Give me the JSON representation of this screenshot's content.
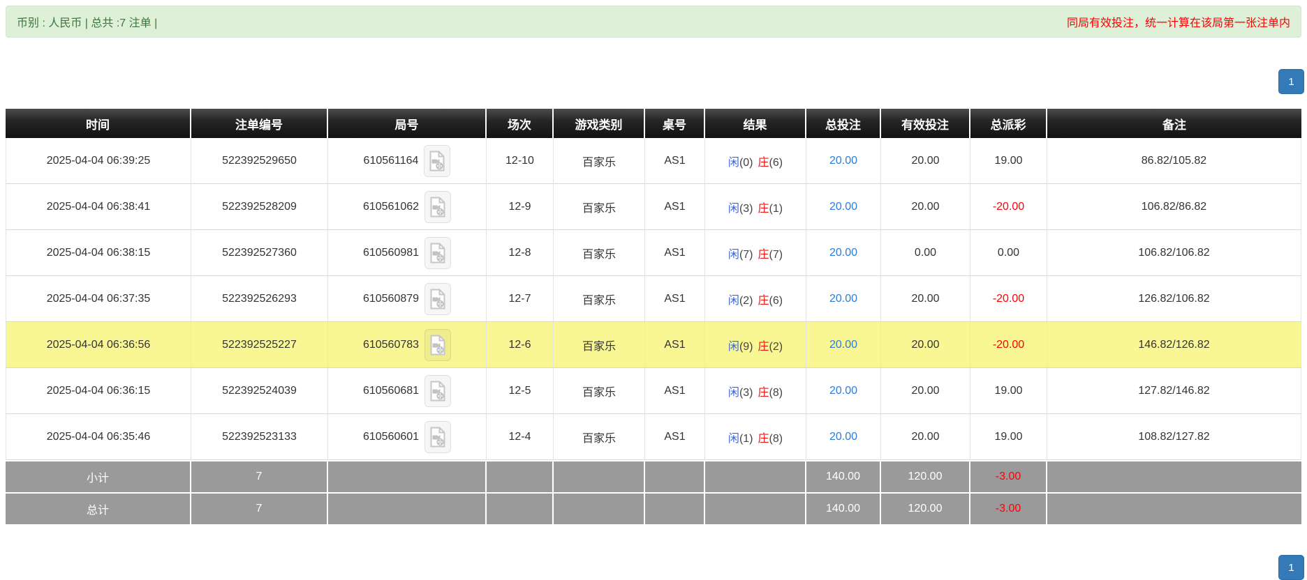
{
  "top_bar": {
    "summary": "币别 : 人民币 | 总共 :7 注单 |",
    "notice": "同局有效投注，统一计算在该局第一张注单内"
  },
  "pagination": {
    "current_page": "1"
  },
  "table": {
    "columns": [
      "时间",
      "注单编号",
      "局号",
      "场次",
      "游戏类别",
      "桌号",
      "结果",
      "总投注",
      "有效投注",
      "总派彩",
      "备注"
    ],
    "icons": {
      "round_cell": "video-file-icon"
    },
    "rows": [
      {
        "time": "2025-04-04 06:39:25",
        "bet_id": "522392529650",
        "round_no": "610561164",
        "session": "12-10",
        "game_type": "百家乐",
        "table_no": "AS1",
        "result": {
          "player_label": "闲",
          "player_score": "(0)",
          "banker_label": "庄",
          "banker_score": "(6)"
        },
        "total_bet": "20.00",
        "valid_bet": "20.00",
        "payout": "19.00",
        "remark": "86.82/105.82",
        "highlighted": false
      },
      {
        "time": "2025-04-04 06:38:41",
        "bet_id": "522392528209",
        "round_no": "610561062",
        "session": "12-9",
        "game_type": "百家乐",
        "table_no": "AS1",
        "result": {
          "player_label": "闲",
          "player_score": "(3)",
          "banker_label": "庄",
          "banker_score": "(1)"
        },
        "total_bet": "20.00",
        "valid_bet": "20.00",
        "payout": "-20.00",
        "remark": "106.82/86.82",
        "highlighted": false
      },
      {
        "time": "2025-04-04 06:38:15",
        "bet_id": "522392527360",
        "round_no": "610560981",
        "session": "12-8",
        "game_type": "百家乐",
        "table_no": "AS1",
        "result": {
          "player_label": "闲",
          "player_score": "(7)",
          "banker_label": "庄",
          "banker_score": "(7)"
        },
        "total_bet": "20.00",
        "valid_bet": "0.00",
        "payout": "0.00",
        "remark": "106.82/106.82",
        "highlighted": false
      },
      {
        "time": "2025-04-04 06:37:35",
        "bet_id": "522392526293",
        "round_no": "610560879",
        "session": "12-7",
        "game_type": "百家乐",
        "table_no": "AS1",
        "result": {
          "player_label": "闲",
          "player_score": "(2)",
          "banker_label": "庄",
          "banker_score": "(6)"
        },
        "total_bet": "20.00",
        "valid_bet": "20.00",
        "payout": "-20.00",
        "remark": "126.82/106.82",
        "highlighted": false
      },
      {
        "time": "2025-04-04 06:36:56",
        "bet_id": "522392525227",
        "round_no": "610560783",
        "session": "12-6",
        "game_type": "百家乐",
        "table_no": "AS1",
        "result": {
          "player_label": "闲",
          "player_score": "(9)",
          "banker_label": "庄",
          "banker_score": "(2)"
        },
        "total_bet": "20.00",
        "valid_bet": "20.00",
        "payout": "-20.00",
        "remark": "146.82/126.82",
        "highlighted": true
      },
      {
        "time": "2025-04-04 06:36:15",
        "bet_id": "522392524039",
        "round_no": "610560681",
        "session": "12-5",
        "game_type": "百家乐",
        "table_no": "AS1",
        "result": {
          "player_label": "闲",
          "player_score": "(3)",
          "banker_label": "庄",
          "banker_score": "(8)"
        },
        "total_bet": "20.00",
        "valid_bet": "20.00",
        "payout": "19.00",
        "remark": "127.82/146.82",
        "highlighted": false
      },
      {
        "time": "2025-04-04 06:35:46",
        "bet_id": "522392523133",
        "round_no": "610560601",
        "session": "12-4",
        "game_type": "百家乐",
        "table_no": "AS1",
        "result": {
          "player_label": "闲",
          "player_score": "(1)",
          "banker_label": "庄",
          "banker_score": "(8)"
        },
        "total_bet": "20.00",
        "valid_bet": "20.00",
        "payout": "19.00",
        "remark": "108.82/127.82",
        "highlighted": false
      }
    ],
    "subtotal": {
      "label": "小计",
      "count": "7",
      "total_bet": "140.00",
      "valid_bet": "120.00",
      "payout": "-3.00"
    },
    "total": {
      "label": "总计",
      "count": "7",
      "total_bet": "140.00",
      "valid_bet": "120.00",
      "payout": "-3.00"
    }
  },
  "colors": {
    "accent_blue": "#337ab7",
    "link_blue": "#2d7bd6",
    "player_blue": "#3b63d4",
    "banker_red": "#ea1515",
    "negative_red": "#ff0000",
    "highlight_yellow": "#f9f694",
    "summary_gray": "#9a9a9a",
    "header_black": "#121212",
    "alert_bg": "#dff0d8",
    "alert_border": "#d6e9c6",
    "alert_text": "#3c763d",
    "notice_red": "#ff0000"
  }
}
